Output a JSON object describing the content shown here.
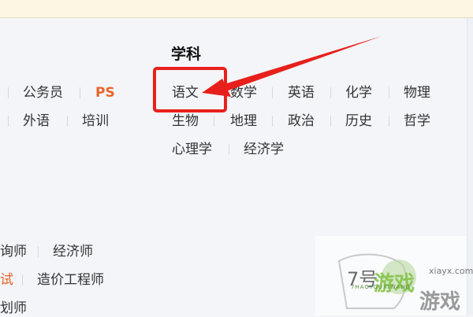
{
  "subject_heading": "学科",
  "row1": [
    "公务员",
    "PS",
    "语文",
    "数学",
    "英语",
    "化学",
    "物理"
  ],
  "row2": [
    "外语",
    "培训",
    "生物",
    "地理",
    "政治",
    "历史",
    "哲学"
  ],
  "row3": [
    "心理学",
    "经济学"
  ],
  "lower1": [
    "询师",
    "经济师"
  ],
  "lower2": [
    "试",
    "造价工程师"
  ],
  "lower3": [
    "划师"
  ],
  "watermark": {
    "number": "7号",
    "main": "游戏",
    "main2": "游戏",
    "sub": "7HAOYOUXIWANG",
    "domain": "xiayx.com"
  },
  "colors": {
    "accent": "#e8642a",
    "highlight": "#e8201c",
    "watermark_green": "#7fc241"
  }
}
